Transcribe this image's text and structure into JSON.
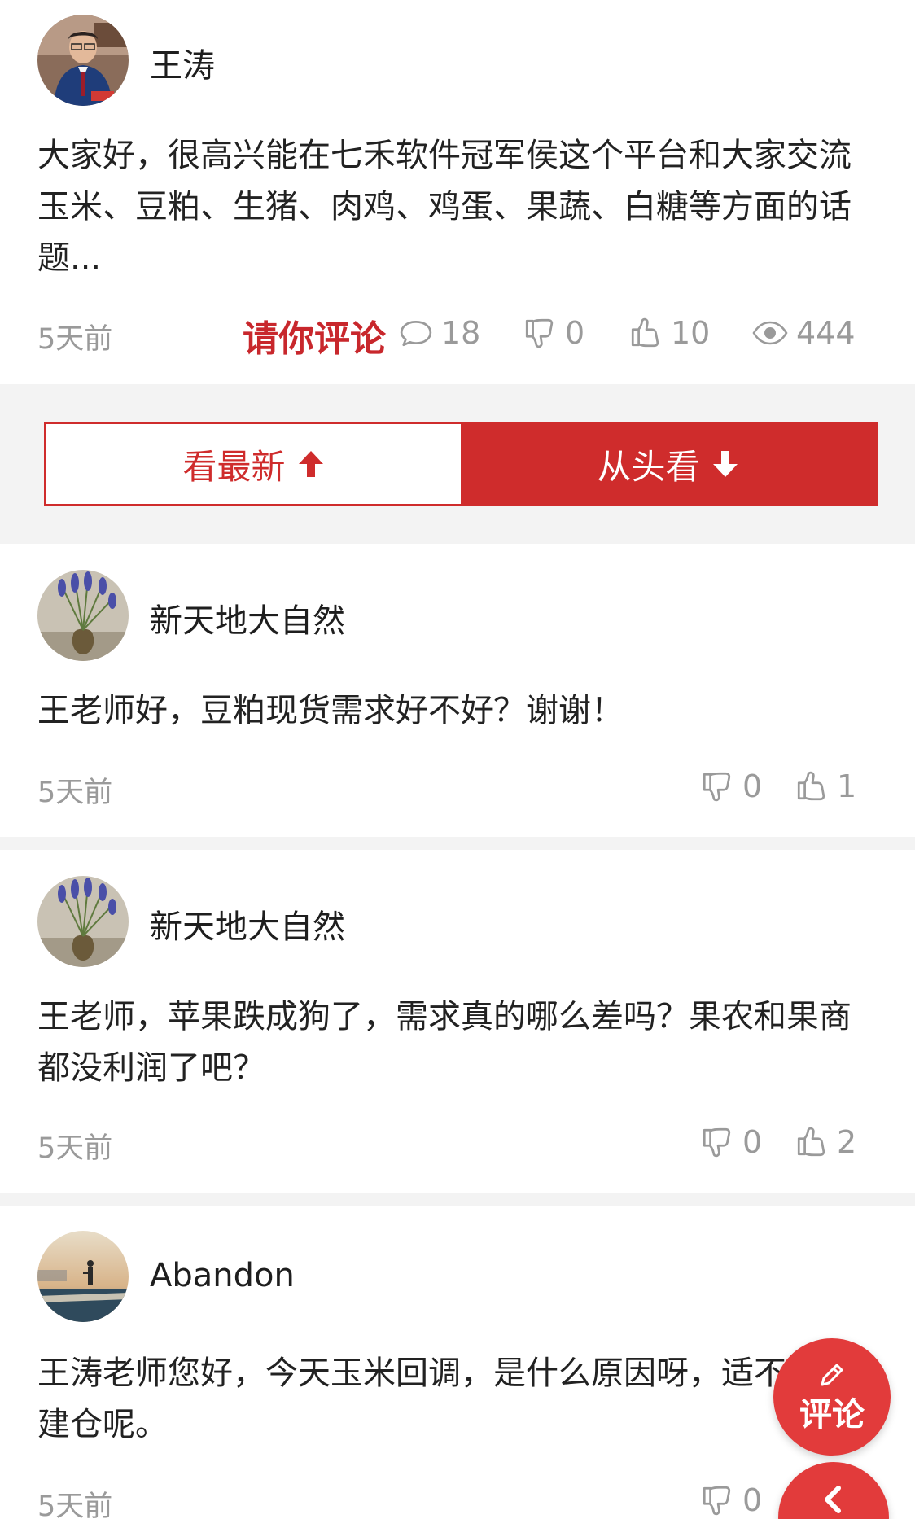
{
  "post": {
    "author": "王涛",
    "text": "大家好，很高兴能在七禾软件冠军侯这个平台和大家交流玉米、豆粕、生猪、肉鸡、鸡蛋、果蔬、白糖等方面的话题...",
    "time": "5天前",
    "invite_label": "请你评论",
    "comments": "18",
    "dislikes": "0",
    "likes": "10",
    "views": "444"
  },
  "tabs": {
    "latest": "看最新",
    "from_start": "从头看"
  },
  "comments": [
    {
      "author": "新天地大自然",
      "text": "王老师好，豆粕现货需求好不好？谢谢！",
      "time": "5天前",
      "dislikes": "0",
      "likes": "1"
    },
    {
      "author": "新天地大自然",
      "text": "王老师，苹果跌成狗了，需求真的哪么差吗？果农和果商都没利润了吧？",
      "time": "5天前",
      "dislikes": "0",
      "likes": "2"
    },
    {
      "author": "Abandon",
      "text": "王涛老师您好，今天玉米回调，是什么原因呀，适不适合建仓呢。",
      "time": "5天前",
      "dislikes": "0",
      "likes": ""
    }
  ],
  "fab": {
    "comment_label": "评论"
  },
  "icons": {
    "comment": "speech-bubble-icon",
    "dislike": "thumbs-down-icon",
    "like": "thumbs-up-icon",
    "views": "eye-icon",
    "arrow_up": "arrow-up-icon",
    "arrow_down": "arrow-down-icon",
    "edit": "pencil-icon",
    "back": "chevron-left-icon"
  },
  "colors": {
    "accent": "#cf2c2c",
    "muted": "#9a9a9a",
    "band": "#f3f3f3"
  }
}
